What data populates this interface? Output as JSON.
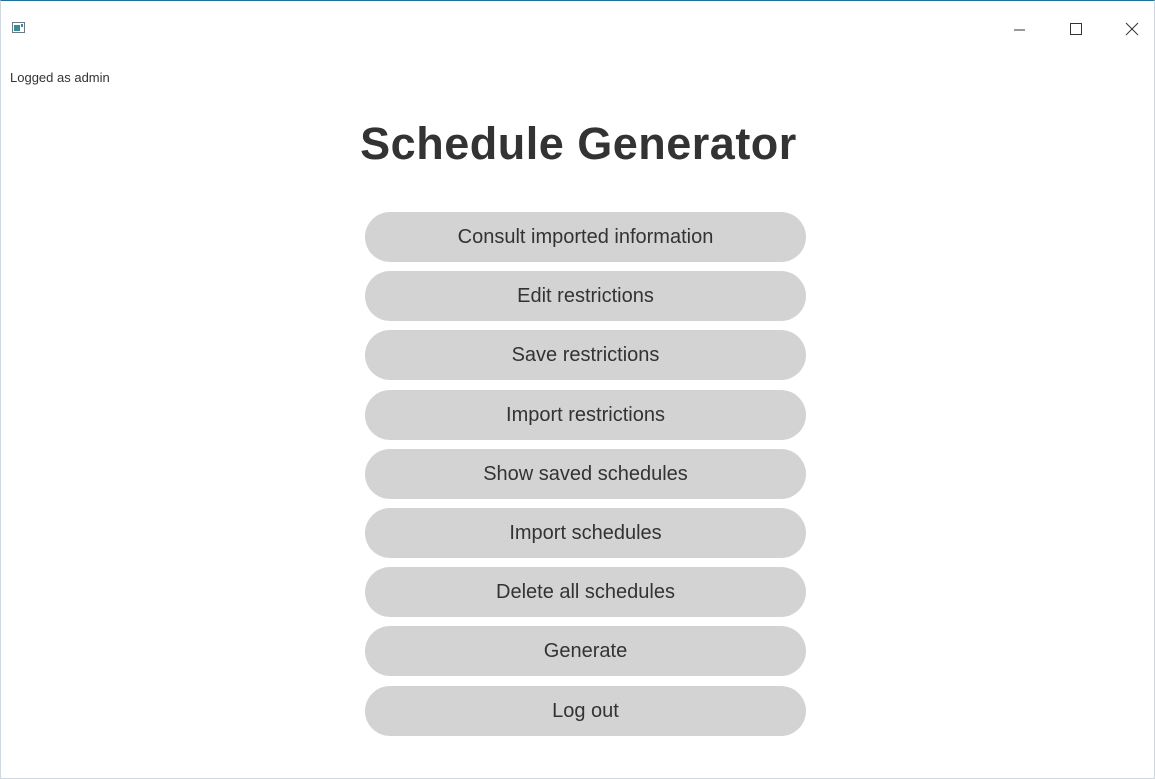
{
  "window": {
    "app_icon": "app-window-icon",
    "controls": {
      "minimize_icon": "minimize-icon",
      "maximize_icon": "maximize-icon",
      "close_icon": "close-icon"
    }
  },
  "header": {
    "logged_text": "Logged as admin"
  },
  "main": {
    "title": "Schedule Generator",
    "buttons": [
      {
        "label": "Consult imported information"
      },
      {
        "label": "Edit restrictions"
      },
      {
        "label": "Save restrictions"
      },
      {
        "label": "Import restrictions"
      },
      {
        "label": "Show saved schedules"
      },
      {
        "label": "Import schedules"
      },
      {
        "label": "Delete all schedules"
      },
      {
        "label": "Generate"
      },
      {
        "label": "Log out"
      }
    ]
  },
  "colors": {
    "background": "#ffffff",
    "button_bg": "#d3d3d3",
    "text": "#333333",
    "window_border": "#1f6f9f"
  }
}
